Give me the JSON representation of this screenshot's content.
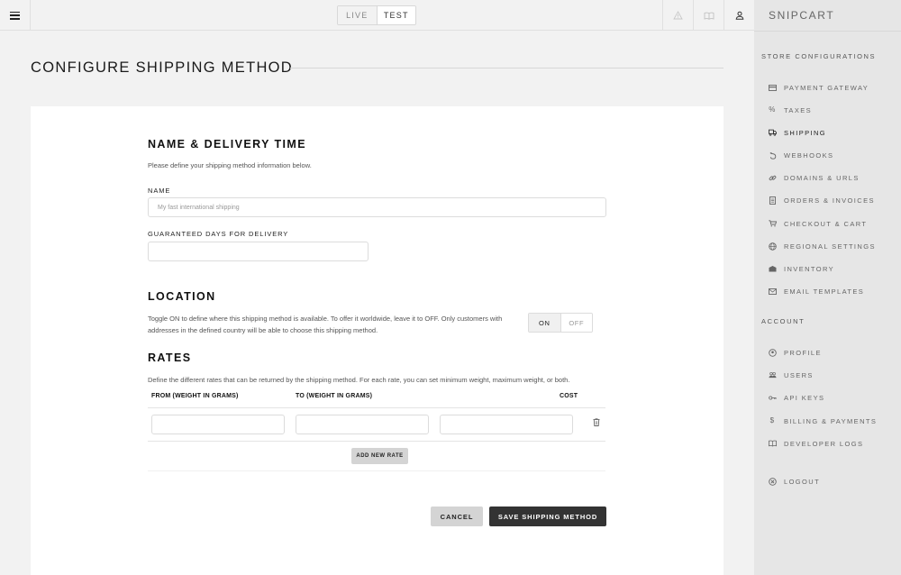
{
  "topbar": {
    "mode_live": "LIVE",
    "mode_test": "TEST",
    "active_mode": "TEST"
  },
  "page": {
    "title": "CONFIGURE SHIPPING METHOD"
  },
  "form": {
    "name_section": {
      "title": "NAME & DELIVERY TIME",
      "description": "Please define your shipping method information below.",
      "name_label": "NAME",
      "name_placeholder": "My fast international shipping",
      "days_label": "GUARANTEED DAYS FOR DELIVERY",
      "days_value": ""
    },
    "location": {
      "title": "LOCATION",
      "description_line1": "Toggle ON to define where this shipping method is available. To offer it worldwide, leave it to OFF. Only customers with",
      "description_line2": "addresses in the defined country will be able to choose this shipping method.",
      "on_label": "ON",
      "off_label": "OFF",
      "selected": "ON"
    },
    "rates": {
      "title": "RATES",
      "description": "Define the different rates that can be returned by the shipping method. For each rate, you can set minimum weight, maximum weight, or both.",
      "columns": [
        "FROM (WEIGHT IN GRAMS)",
        "TO (WEIGHT IN GRAMS)",
        "COST"
      ],
      "rows": [
        {
          "from": "",
          "to": "",
          "cost": ""
        }
      ],
      "add_label": "ADD NEW RATE"
    },
    "actions": {
      "cancel": "CANCEL",
      "save": "SAVE SHIPPING METHOD"
    }
  },
  "sidebar": {
    "brand": "SNIPCART",
    "store_heading": "STORE CONFIGURATIONS",
    "store_items": [
      {
        "label": "PAYMENT GATEWAY",
        "icon": "credit-card-icon",
        "active": false
      },
      {
        "label": "TAXES",
        "icon": "percent-icon",
        "active": false
      },
      {
        "label": "SHIPPING",
        "icon": "truck-icon",
        "active": true
      },
      {
        "label": "WEBHOOKS",
        "icon": "hook-icon",
        "active": false
      },
      {
        "label": "DOMAINS & URLS",
        "icon": "link-icon",
        "active": false
      },
      {
        "label": "ORDERS & INVOICES",
        "icon": "invoice-icon",
        "active": false
      },
      {
        "label": "CHECKOUT & CART",
        "icon": "cart-icon",
        "active": false
      },
      {
        "label": "REGIONAL SETTINGS",
        "icon": "globe-icon",
        "active": false
      },
      {
        "label": "INVENTORY",
        "icon": "inventory-icon",
        "active": false
      },
      {
        "label": "EMAIL TEMPLATES",
        "icon": "envelope-icon",
        "active": false
      }
    ],
    "account_heading": "ACCOUNT",
    "account_items": [
      {
        "label": "PROFILE",
        "icon": "profile-icon"
      },
      {
        "label": "USERS",
        "icon": "users-icon"
      },
      {
        "label": "API KEYS",
        "icon": "key-icon"
      },
      {
        "label": "BILLING & PAYMENTS",
        "icon": "dollar-icon"
      },
      {
        "label": "DEVELOPER LOGS",
        "icon": "book-icon"
      }
    ],
    "logout": {
      "label": "LOGOUT",
      "icon": "logout-icon"
    }
  },
  "colors": {
    "background": "#f2f2f2",
    "sidebar": "#e6e6e6",
    "primary_button": "#333333",
    "secondary_button": "#d4d4d4"
  }
}
